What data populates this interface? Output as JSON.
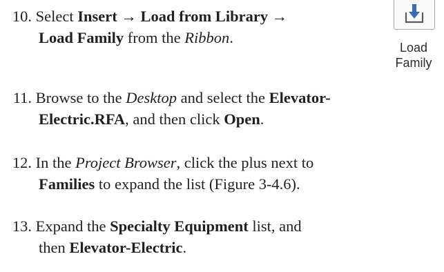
{
  "ribbon_tool": {
    "icon": "load-family-icon",
    "label_line1": "Load",
    "label_line2": "Family"
  },
  "steps": [
    {
      "number": "10.",
      "t1": "Select ",
      "b1": "Insert → Load from Library →",
      "b2": "Load Family",
      "t2": " from the ",
      "i1": "Ribbon",
      "t3": "."
    },
    {
      "number": "11.",
      "t1": "Browse to the ",
      "i1": "Desktop",
      "t2": " and select the ",
      "b1": "Elevator-",
      "b2": "Electric.RFA",
      "t3": ", and then click ",
      "b3": "Open",
      "t4": "."
    },
    {
      "number": "12.",
      "t1": "In the ",
      "i1": "Project Browser",
      "t2": ", click the plus next to",
      "b1": "Families",
      "t3": " to expand the list (Figure 3-4.6)."
    },
    {
      "number": "13.",
      "t1": "Expand the ",
      "b1": "Specialty Equipment",
      "t2": " list, and",
      "t3": "then ",
      "b2": "Elevator-Electric",
      "t4": "."
    }
  ]
}
